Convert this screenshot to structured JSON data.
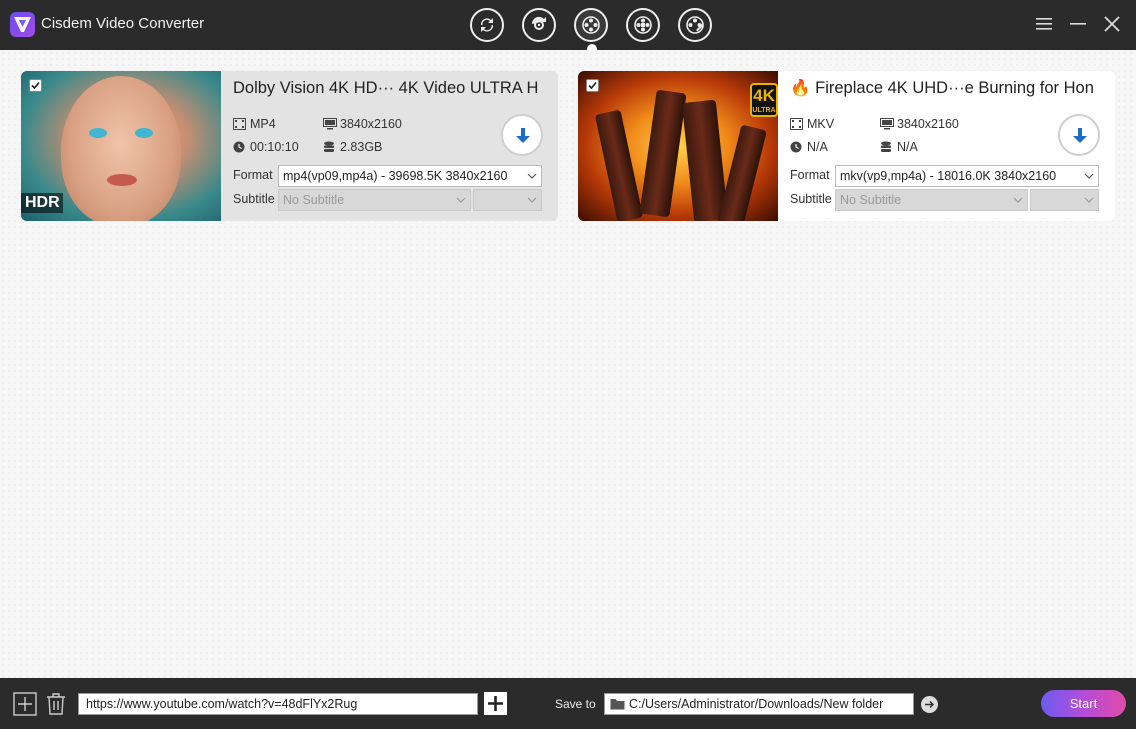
{
  "app": {
    "title": "Cisdem Video Converter"
  },
  "colors": {
    "titlebar": "#2b2b2b",
    "accent": "#1a6fc4",
    "start_gradient": [
      "#6c5cf2",
      "#e24ba8"
    ]
  },
  "modes": [
    {
      "name": "convert-mode-icon",
      "active": false
    },
    {
      "name": "rip-mode-icon",
      "active": false
    },
    {
      "name": "download-mode-icon",
      "active": true
    },
    {
      "name": "dvd-mode-icon",
      "active": false
    },
    {
      "name": "edit-mode-icon",
      "active": false
    }
  ],
  "cards": [
    {
      "checked": true,
      "title": "Dolby Vision 4K HD··· 4K Video ULTRA H",
      "container": "MP4",
      "resolution": "3840x2160",
      "duration": "00:10:10",
      "size": "2.83GB",
      "format_label": "Format",
      "format_value": "mp4(vp09,mp4a) - 39698.5K 3840x2160",
      "subtitle_label": "Subtitle",
      "subtitle_value": "No Subtitle",
      "thumb_badge": "HDR"
    },
    {
      "checked": true,
      "title": "🔥 Fireplace 4K UHD···e Burning for Hon",
      "container": "MKV",
      "resolution": "3840x2160",
      "duration": "N/A",
      "size": "N/A",
      "format_label": "Format",
      "format_value": "mkv(vp9,mp4a) - 18016.0K 3840x2160",
      "subtitle_label": "Subtitle",
      "subtitle_value": "No Subtitle",
      "thumb_badge": "4K",
      "thumb_badge_sub": "ULTRA"
    }
  ],
  "bottom": {
    "url_value": "https://www.youtube.com/watch?v=48dFlYx2Rug",
    "save_label": "Save to",
    "save_path": "C:/Users/Administrator/Downloads/New folder",
    "start_label": "Start"
  }
}
